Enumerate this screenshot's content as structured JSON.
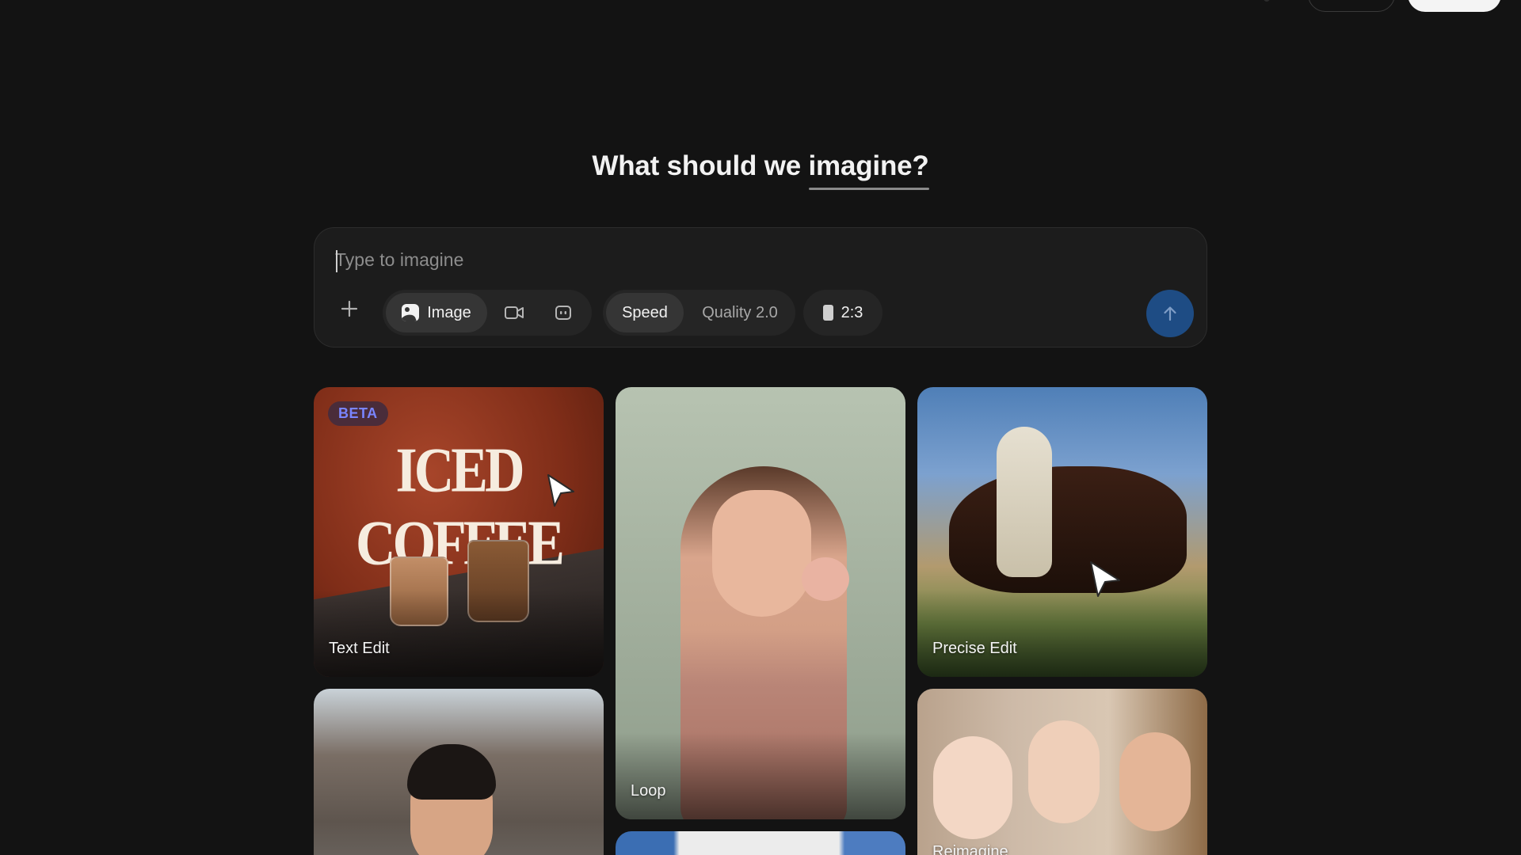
{
  "heading": {
    "prefix": "What should we",
    "highlight": "imagine?"
  },
  "prompt": {
    "placeholder": "Type to imagine",
    "add_icon": "plus-icon",
    "modes": [
      {
        "label": "Image",
        "icon": "image-icon",
        "active": true
      },
      {
        "label": "",
        "icon": "video-camera-icon",
        "active": false
      },
      {
        "label": "",
        "icon": "robot-icon",
        "active": false
      }
    ],
    "quality": {
      "speed_label": "Speed",
      "quality_label": "Quality 2.0",
      "active": "Speed"
    },
    "aspect_ratio": "2:3",
    "send_icon": "arrow-up-icon",
    "send_color": "#1e4c84"
  },
  "gallery": [
    {
      "label": "Text Edit",
      "badge": "BETA",
      "artwork_text": "ICED COFFEE"
    },
    {
      "label": "Loop"
    },
    {
      "label": "Precise Edit"
    },
    {
      "label": ""
    },
    {
      "label": ""
    },
    {
      "label": "Reimagine"
    }
  ],
  "colors": {
    "background": "#131313",
    "panel": "#1c1c1c",
    "accent": "#1e4c84",
    "beta_text": "#7a85ff"
  }
}
